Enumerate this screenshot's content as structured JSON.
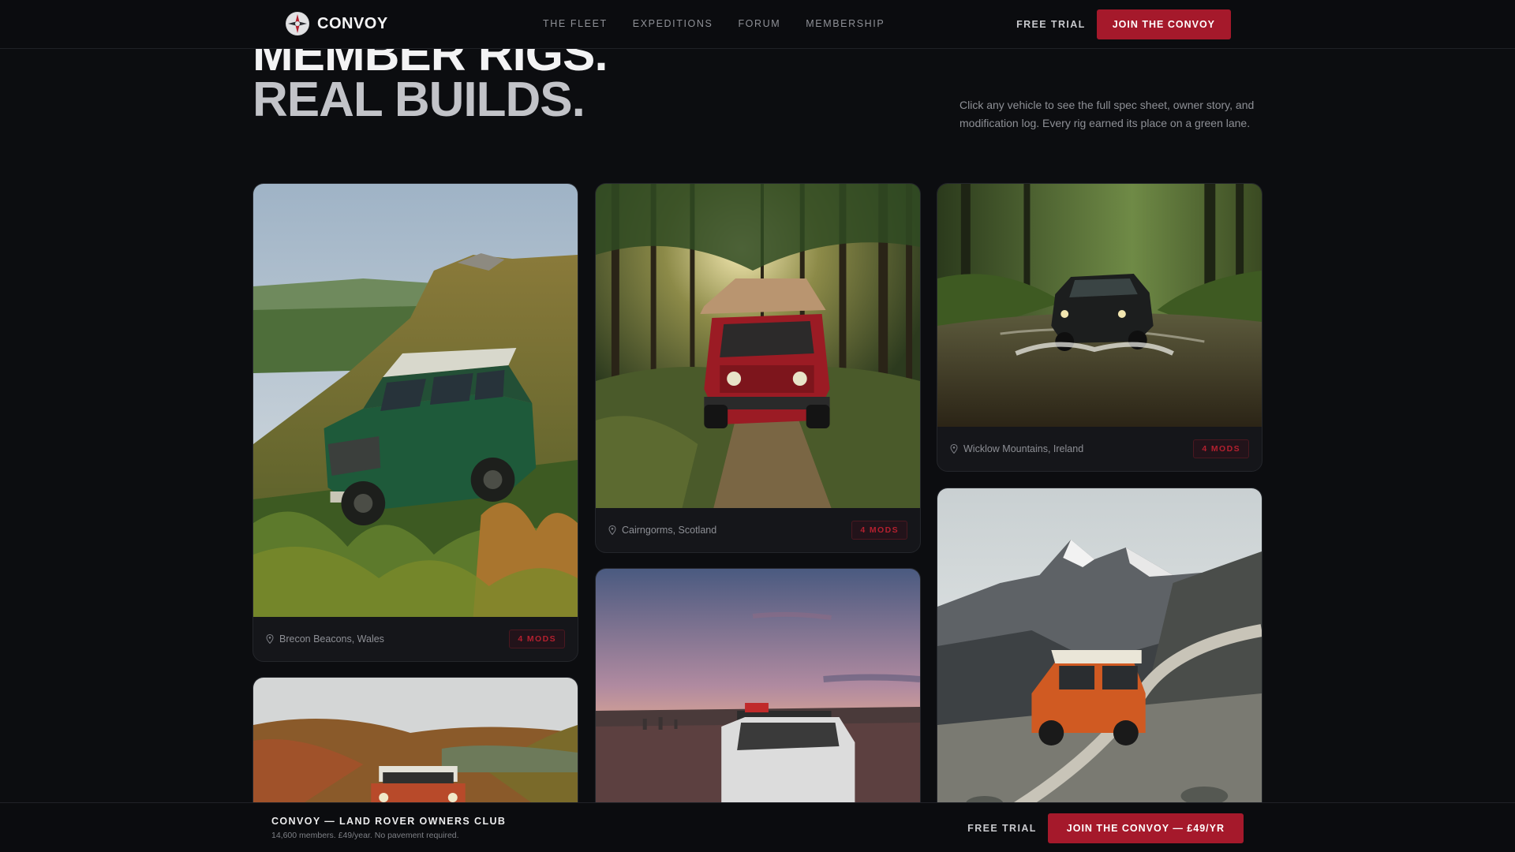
{
  "nav": {
    "brand": "CONVOY",
    "links": [
      "THE FLEET",
      "EXPEDITIONS",
      "FORUM",
      "MEMBERSHIP"
    ],
    "free_trial": "FREE TRIAL",
    "join": "JOIN THE CONVOY"
  },
  "hero": {
    "line1": "MEMBER RIGS.",
    "line2": "REAL BUILDS.",
    "description": "Click any vehicle to see the full spec sheet, owner story, and modification log. Every rig earned its place on a green lane."
  },
  "cards": [
    {
      "location": "Brecon Beacons, Wales",
      "mods": "4 MODS"
    },
    {
      "location": "Cairngorms, Scotland",
      "mods": "4 MODS"
    },
    {
      "location": "Wicklow Mountains, Ireland",
      "mods": "4 MODS"
    }
  ],
  "bottom_bar": {
    "title": "CONVOY — LAND ROVER OWNERS CLUB",
    "subtitle": "14,600 members. £49/year. No pavement required.",
    "free_trial": "FREE TRIAL",
    "join": "JOIN THE CONVOY — £49/YR"
  },
  "colors": {
    "accent": "#a5192b",
    "background": "#0c0d10",
    "card": "#15161a"
  }
}
